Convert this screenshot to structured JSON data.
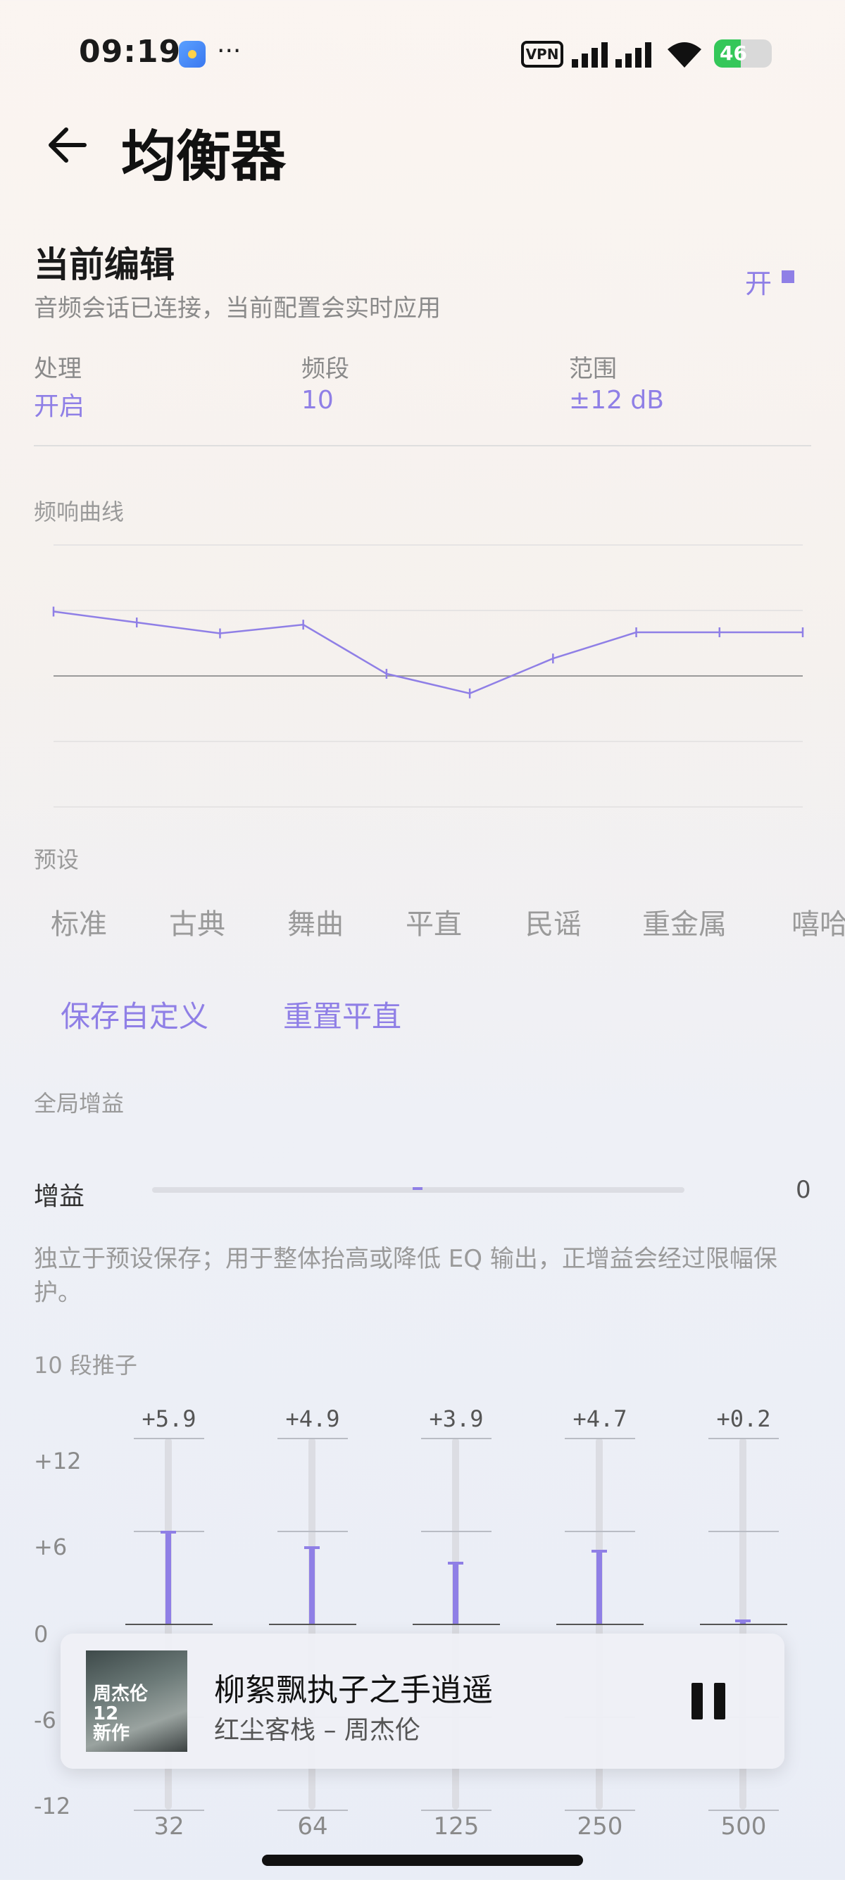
{
  "status_bar": {
    "time": "09:19",
    "more": "···",
    "vpn": "VPN",
    "battery_level": "46",
    "battery_fraction": 0.46
  },
  "header": {
    "title": "均衡器"
  },
  "edit": {
    "title": "当前编辑",
    "subtitle": "音频会话已连接，当前配置会实时应用",
    "toggle_label": "开"
  },
  "info": [
    {
      "label": "处理",
      "value": "开启"
    },
    {
      "label": "频段",
      "value": "10"
    },
    {
      "label": "范围",
      "value": "±12  dB"
    }
  ],
  "curve": {
    "label": "频响曲线",
    "points": [
      5.9,
      4.9,
      3.9,
      4.7,
      0.2,
      -1.6,
      1.6,
      4.0,
      4.0,
      4.0
    ],
    "accent": "#8f7fe6"
  },
  "presets": {
    "label": "预设",
    "items": [
      "标准",
      "古典",
      "舞曲",
      "平直",
      "民谣",
      "重金属",
      "嘻哈"
    ],
    "save_label": "保存自定义",
    "reset_label": "重置平直"
  },
  "gain": {
    "section_label": "全局增益",
    "label": "增益",
    "value": "0",
    "note": "独立于预设保存；用于整体抬高或降低 EQ 输出，正增益会经过限幅保护。"
  },
  "faders": {
    "label": "10  段推子",
    "y_labels": [
      "+12",
      "+6",
      "0",
      "-6",
      "-12"
    ],
    "bands": [
      {
        "freq": "32",
        "value_label": "+5.9",
        "value": 5.9
      },
      {
        "freq": "64",
        "value_label": "+4.9",
        "value": 4.9
      },
      {
        "freq": "125",
        "value_label": "+3.9",
        "value": 3.9
      },
      {
        "freq": "250",
        "value_label": "+4.7",
        "value": 4.7
      },
      {
        "freq": "500",
        "value_label": "+0.2",
        "value": 0.2
      }
    ]
  },
  "player": {
    "title": "柳絮飘执子之手逍遥",
    "artist": "红尘客栈 – 周杰伦",
    "art_text": "周杰伦\n12\n新作"
  }
}
